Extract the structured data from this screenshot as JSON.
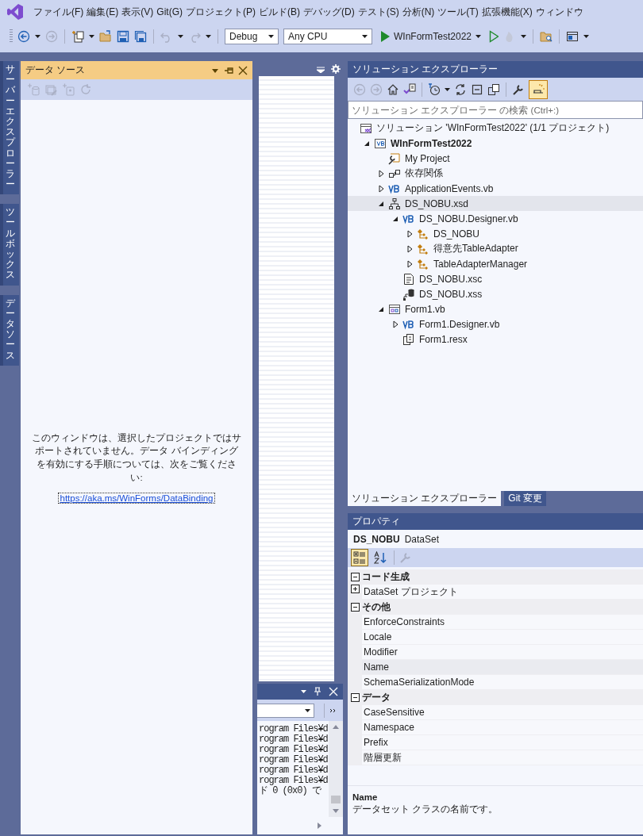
{
  "menu_bar": {
    "items": [
      "ファイル(F)",
      "編集(E)",
      "表示(V)",
      "Git(G)",
      "プロジェクト(P)",
      "ビルド(B)",
      "デバッグ(D)",
      "テスト(S)",
      "分析(N)",
      "ツール(T)",
      "拡張機能(X)",
      "ウィンドウ"
    ]
  },
  "toolbar": {
    "configuration": "Debug",
    "platform": "Any CPU",
    "start_target": "WInFormTest2022"
  },
  "side_tabs": [
    "サーバーエクスプローラー",
    "ツールボックス",
    "データソース"
  ],
  "data_sources": {
    "title": "データ ソース",
    "active": true,
    "message": "このウィンドウは、選択したプロジェクトではサポートされていません。データ バインディングを有効にする手順については、次をご覧ください:",
    "link": "https://aka.ms/WinForms/DataBinding"
  },
  "output": {
    "lines": [
      "rogram Files¥d",
      "rogram Files¥d",
      "rogram Files¥d",
      "rogram Files¥d",
      "rogram Files¥d",
      "rogram Files¥d",
      "ド 0 (0x0) で"
    ]
  },
  "solution_explorer": {
    "title": "ソリューション エクスプローラー",
    "preview_selected_items": true,
    "search_placeholder": "ソリューション エクスプローラー の検索 (Ctrl+:)",
    "tree": [
      {
        "label": "ソリューション 'WInFormTest2022' (1/1 プロジェクト)",
        "kind": "solution",
        "selected": false,
        "children": [
          {
            "label": "WInFormTest2022",
            "kind": "vb-project",
            "expanded": true,
            "selected": false,
            "children": [
              {
                "label": "My Project",
                "kind": "my-project",
                "selected": false
              },
              {
                "label": "依存関係",
                "kind": "dependencies",
                "expanded": false,
                "selected": false
              },
              {
                "label": "ApplicationEvents.vb",
                "kind": "vb",
                "expanded": false,
                "selected": false
              },
              {
                "label": "DS_NOBU.xsd",
                "kind": "xsd",
                "expanded": true,
                "selected": true,
                "children": [
                  {
                    "label": "DS_NOBU.Designer.vb",
                    "kind": "vb",
                    "expanded": true,
                    "selected": false,
                    "children": [
                      {
                        "label": "DS_NOBU",
                        "kind": "class",
                        "expanded": false,
                        "selected": false
                      },
                      {
                        "label": "得意先TableAdapter",
                        "kind": "class",
                        "expanded": false,
                        "selected": false
                      },
                      {
                        "label": "TableAdapterManager",
                        "kind": "class",
                        "expanded": false,
                        "selected": false
                      }
                    ]
                  },
                  {
                    "label": "DS_NOBU.xsc",
                    "kind": "xsc",
                    "selected": false
                  },
                  {
                    "label": "DS_NOBU.xss",
                    "kind": "xss",
                    "selected": false
                  }
                ]
              },
              {
                "label": "Form1.vb",
                "kind": "form",
                "expanded": true,
                "selected": false,
                "children": [
                  {
                    "label": "Form1.Designer.vb",
                    "kind": "vb",
                    "expanded": false,
                    "selected": false
                  },
                  {
                    "label": "Form1.resx",
                    "kind": "resx",
                    "selected": false
                  }
                ]
              }
            ]
          }
        ]
      }
    ],
    "tabs": [
      {
        "label": "ソリューション エクスプローラー",
        "selected": true
      },
      {
        "label": "Git 変更",
        "selected": false
      }
    ]
  },
  "properties": {
    "title": "プロパティ",
    "object_name": "DS_NOBU",
    "object_type": "DataSet",
    "view_buttons": [
      {
        "kind": "categorized",
        "selected": true
      },
      {
        "kind": "alphabetical",
        "selected": false
      }
    ],
    "categories": [
      {
        "label": "コード生成",
        "expanded": true,
        "properties": [
          {
            "name": "DataSet プロジェクト",
            "expanded": false,
            "selected": false
          }
        ]
      },
      {
        "label": "その他",
        "expanded": true,
        "properties": [
          {
            "name": "EnforceConstraints",
            "selected": false
          },
          {
            "name": "Locale",
            "selected": false
          },
          {
            "name": "Modifier",
            "selected": false
          },
          {
            "name": "Name",
            "selected": true
          },
          {
            "name": "SchemaSerializationMode",
            "selected": false
          }
        ]
      },
      {
        "label": "データ",
        "expanded": true,
        "properties": [
          {
            "name": "CaseSensitive",
            "selected": false
          },
          {
            "name": "Namespace",
            "selected": false
          },
          {
            "name": "Prefix",
            "selected": false
          },
          {
            "name": "階層更新",
            "selected": false
          }
        ]
      }
    ],
    "description": {
      "title": "Name",
      "text": "データセット クラスの名前です。"
    }
  }
}
